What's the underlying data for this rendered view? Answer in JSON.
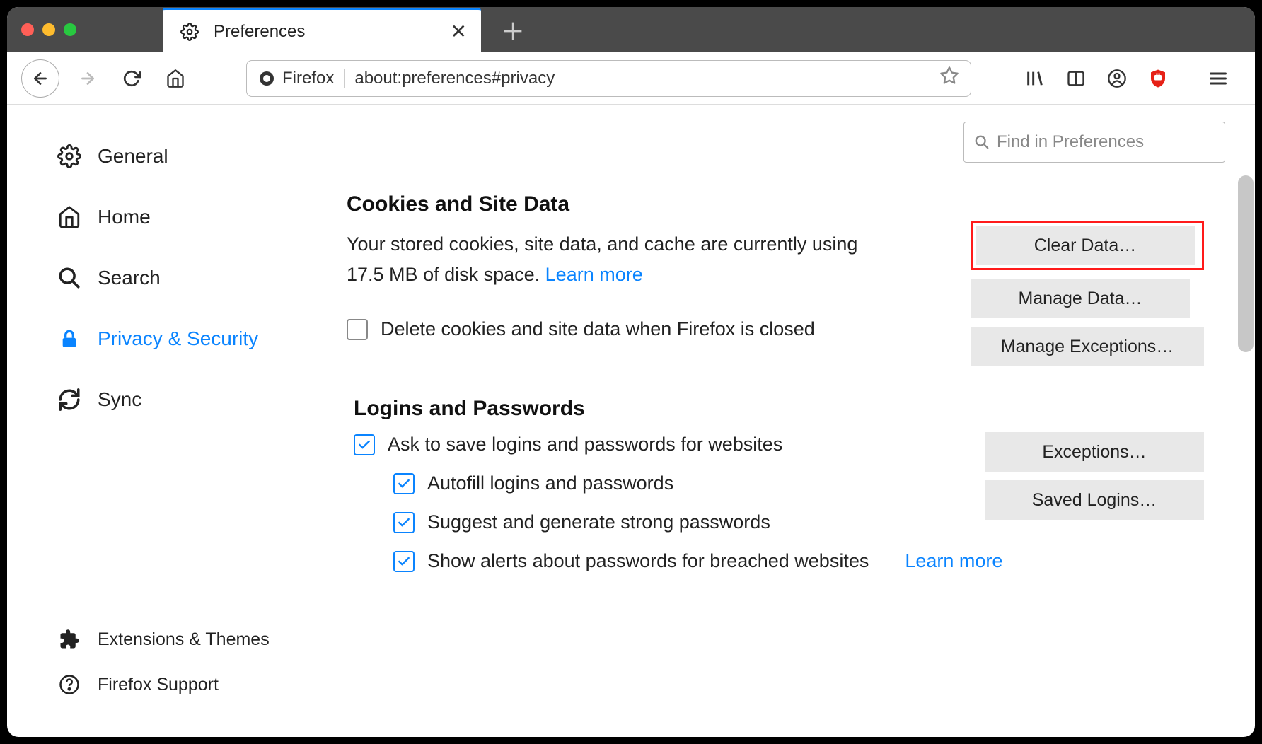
{
  "tab": {
    "title": "Preferences"
  },
  "url": {
    "identity_text": "Firefox",
    "address": "about:preferences#privacy"
  },
  "search": {
    "placeholder": "Find in Preferences"
  },
  "sidebar": {
    "items": [
      {
        "label": "General"
      },
      {
        "label": "Home"
      },
      {
        "label": "Search"
      },
      {
        "label": "Privacy & Security"
      },
      {
        "label": "Sync"
      }
    ],
    "footer": [
      {
        "label": "Extensions & Themes"
      },
      {
        "label": "Firefox Support"
      }
    ]
  },
  "cookies": {
    "heading": "Cookies and Site Data",
    "desc_prefix": "Your stored cookies, site data, and cache are currently using ",
    "size": "17.5 MB",
    "desc_suffix": " of disk space.   ",
    "learn_more": "Learn more",
    "delete_checkbox": "Delete cookies and site data when Firefox is closed",
    "buttons": {
      "clear": "Clear Data…",
      "manage": "Manage Data…",
      "exceptions": "Manage Exceptions…"
    }
  },
  "logins": {
    "heading": "Logins and Passwords",
    "ask": "Ask to save logins and passwords for websites",
    "autofill": "Autofill logins and passwords",
    "suggest": "Suggest and generate strong passwords",
    "alerts": "Show alerts about passwords for breached websites",
    "learn_more": "Learn more",
    "buttons": {
      "exceptions": "Exceptions…",
      "saved": "Saved Logins…"
    }
  }
}
